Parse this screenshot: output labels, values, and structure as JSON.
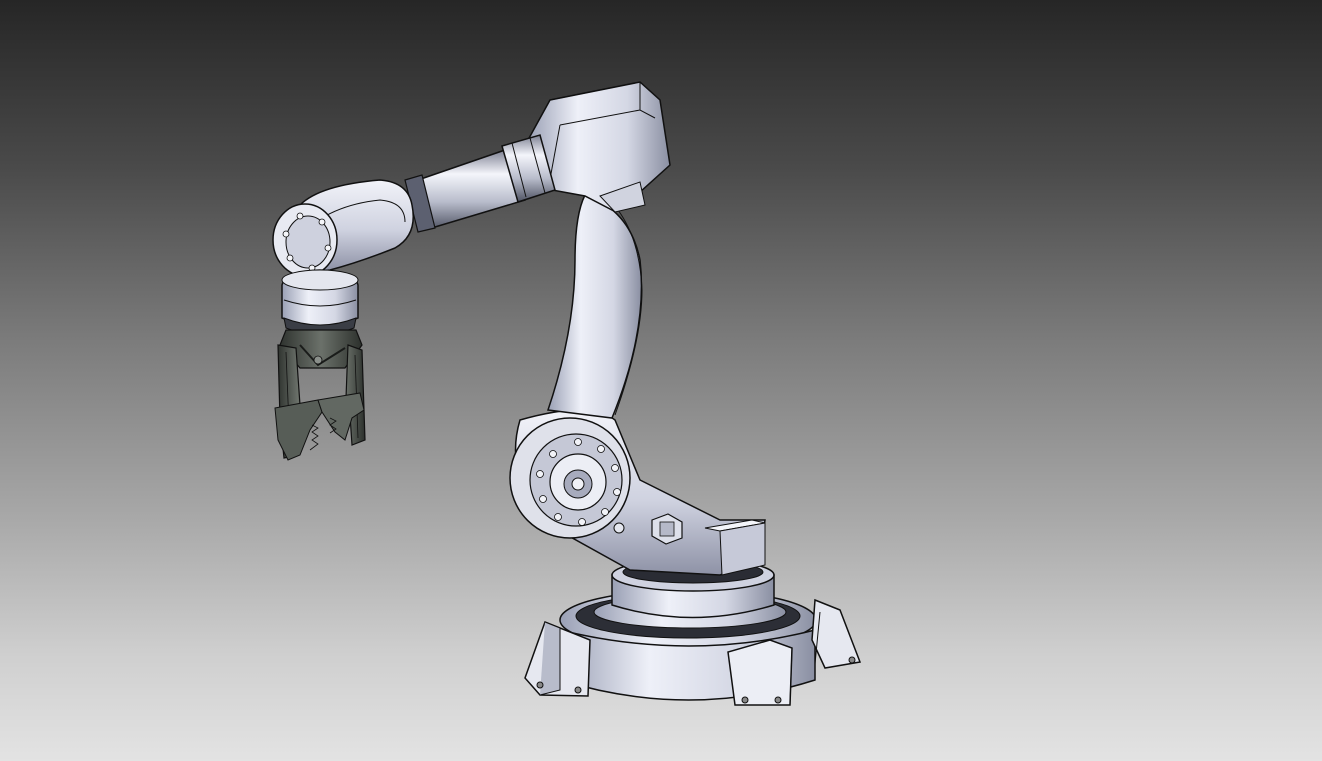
{
  "viewport": {
    "background_top": "#262626",
    "background_bottom": "#e3e3e3"
  },
  "model": {
    "render_style": "shaded-with-edges",
    "colors": {
      "body": "#d9dbe6",
      "body_shadow": "#8e92a3",
      "edge": "#111111",
      "dark_part": "#4a4f4a"
    }
  }
}
